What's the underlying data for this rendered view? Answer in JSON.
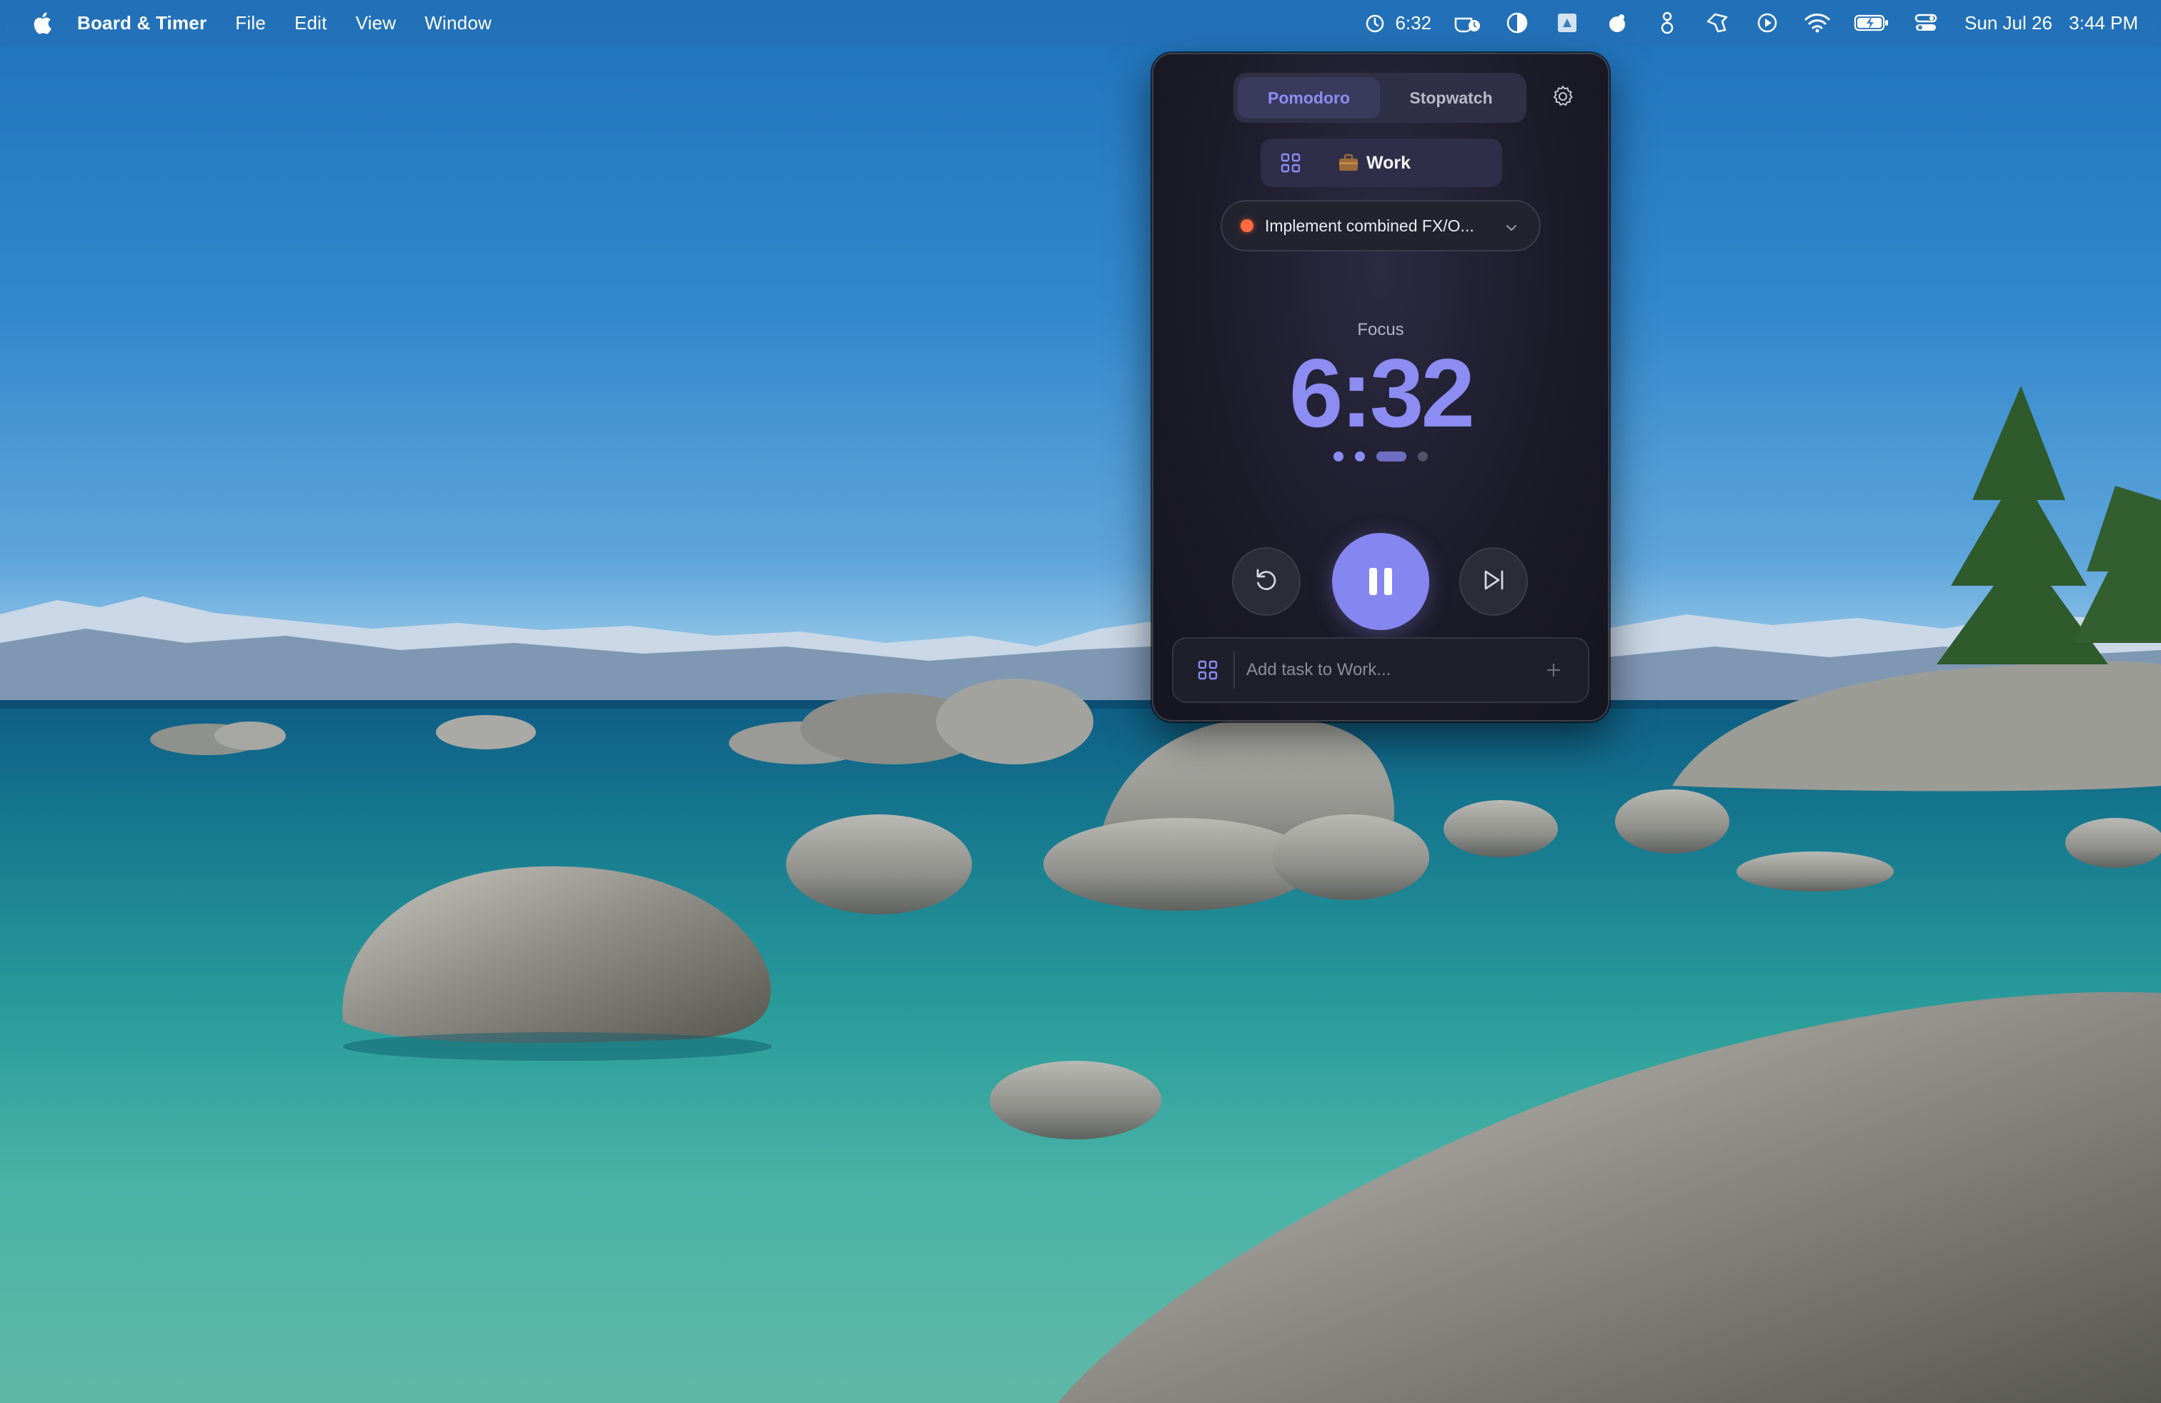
{
  "menubar": {
    "app_name": "Board & Timer",
    "menus": [
      "File",
      "Edit",
      "View",
      "Window"
    ],
    "timer_readout": "6:32",
    "date": "Sun Jul 26",
    "time": "3:44 PM",
    "status_icons": [
      "timer-icon",
      "caffeine-icon",
      "contrast-icon",
      "window-icon",
      "focus-icon",
      "gitbook-icon",
      "hand-icon",
      "play-circle-icon",
      "wifi-icon",
      "battery-charging-icon",
      "control-center-icon"
    ]
  },
  "panel": {
    "tabs": [
      {
        "label": "Pomodoro",
        "active": true
      },
      {
        "label": "Stopwatch",
        "active": false
      }
    ],
    "board": {
      "label": "Work",
      "icon": "briefcase-icon"
    },
    "current_task": {
      "label": "Implement combined FX/O...",
      "status_color": "#ff6b3d"
    },
    "phase_label": "Focus",
    "time_remaining": "6:32",
    "session_progress": {
      "completed": 2,
      "current": 3,
      "total": 4
    },
    "add_task": {
      "placeholder": "Add task to Work..."
    },
    "accent_color": "#8c8cf2"
  }
}
